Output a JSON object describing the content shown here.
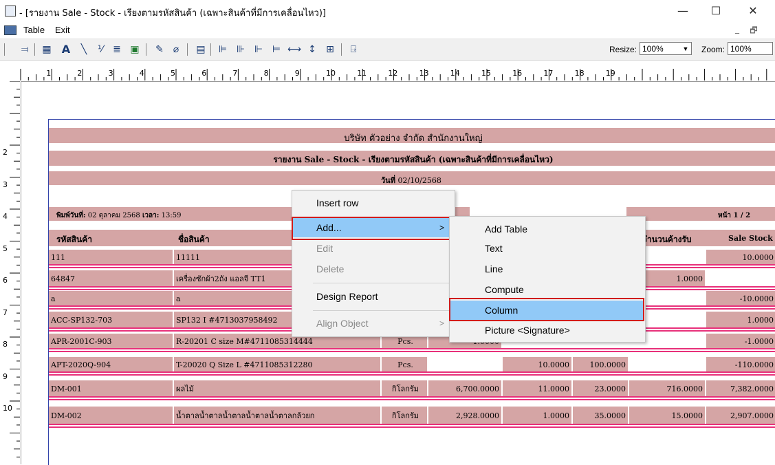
{
  "window": {
    "title": "- [รายงาน Sale - Stock - เรียงตามรหัสสินค้า (เฉพาะสินค้าที่มีการเคลื่อนไหว)]",
    "minimize": "—",
    "maximize": "☐",
    "close": "✕"
  },
  "menubar": {
    "items": [
      "Table",
      "Exit"
    ],
    "mdi_min": "_",
    "mdi_restore": "🗗"
  },
  "toolbar": {
    "resize_label": "Resize:",
    "resize_value": "100%",
    "zoom_label": "Zoom:",
    "zoom_value": "100%"
  },
  "ruler": {
    "h": [
      "1",
      "2",
      "3",
      "4",
      "5",
      "6",
      "7",
      "8",
      "9",
      "10",
      "11",
      "12",
      "13",
      "14",
      "15",
      "16",
      "17",
      "18",
      "19"
    ],
    "v": [
      "2",
      "3",
      "4",
      "5",
      "6",
      "7",
      "8",
      "9",
      "10"
    ]
  },
  "report": {
    "company": "บริษัท ตัวอย่าง จำกัด   สำนักงานใหญ่",
    "title": "รายงาน Sale - Stock - เรียงตามรหัสสินค้า (เฉพาะสินค้าที่มีการเคลื่อนไหว)",
    "date_label": "วันที่",
    "date_value": "02/10/2568",
    "printed_label": "พิมพ์วันที่:",
    "printed_value": "02 ตุลาคม 2568",
    "time_label": "เวลา:",
    "time_value": "13:59",
    "page_label": "หน้า 1 / 2",
    "headers": {
      "code": "รหัสสินค้า",
      "name": "ชื่อสินค้า",
      "pending": "จำนวนค้างรับ",
      "sale_stock": "Sale Stock"
    },
    "rows": [
      {
        "code": "111",
        "name": "11111",
        "unit": "",
        "c1": "",
        "c2": "",
        "c3": "",
        "c4": "",
        "ss": "10.0000"
      },
      {
        "code": "64847",
        "name": "เครื่องซักผ้า2ถัง แอลจี TT1",
        "unit": "",
        "c1": "",
        "c2": "",
        "c3": "",
        "c4": "1.0000",
        "ss": ""
      },
      {
        "code": "a",
        "name": "a",
        "unit": "",
        "c1": "",
        "c2": "",
        "c3": "",
        "c4": "",
        "ss": "-10.0000"
      },
      {
        "code": "ACC-SP132-703",
        "name": "SP132 I #4713037958492",
        "unit": "Pcs.",
        "c1": "",
        "c2": "",
        "c3": "",
        "c4": "",
        "ss": "1.0000"
      },
      {
        "code": "APR-2001C-903",
        "name": "R-20201 C size M#4711085314444",
        "unit": "Pcs.",
        "c1": "-1.0000",
        "c2": "",
        "c3": "",
        "c4": "",
        "ss": "-1.0000"
      },
      {
        "code": "APT-2020Q-904",
        "name": "T-20020 Q Size L #4711085312280",
        "unit": "Pcs.",
        "c1": "",
        "c2": "10.0000",
        "c3": "100.0000",
        "c4": "",
        "ss": "-110.0000"
      },
      {
        "code": "DM-001",
        "name": "ผลไม้",
        "unit": "กิโลกรัม",
        "c1": "6,700.0000",
        "c2": "11.0000",
        "c3": "23.0000",
        "c4": "716.0000",
        "ss": "7,382.0000"
      },
      {
        "code": "DM-002",
        "name": "น้ำตาลน้ำตาลน้ำตาลน้ำตาลน้ำตาลกล้วยก",
        "unit": "กิโลกรัม",
        "c1": "2,928.0000",
        "c2": "1.0000",
        "c3": "35.0000",
        "c4": "15.0000",
        "ss": "2,907.0000"
      }
    ]
  },
  "context_menu": {
    "items": [
      "Insert row",
      "Add...",
      "Edit",
      "Delete",
      "Design Report",
      "Align Object"
    ],
    "disabled": [
      false,
      false,
      true,
      true,
      false,
      true
    ]
  },
  "submenu": {
    "items": [
      "Add Table",
      "Text",
      "Line",
      "Compute",
      "Column",
      "Picture <Signature>"
    ],
    "highlighted": "Column"
  },
  "colors": {
    "band": "#d5a5a5",
    "accent_line": "#e8307a",
    "highlight": "#91c9f7",
    "callout": "#d01c1c"
  }
}
